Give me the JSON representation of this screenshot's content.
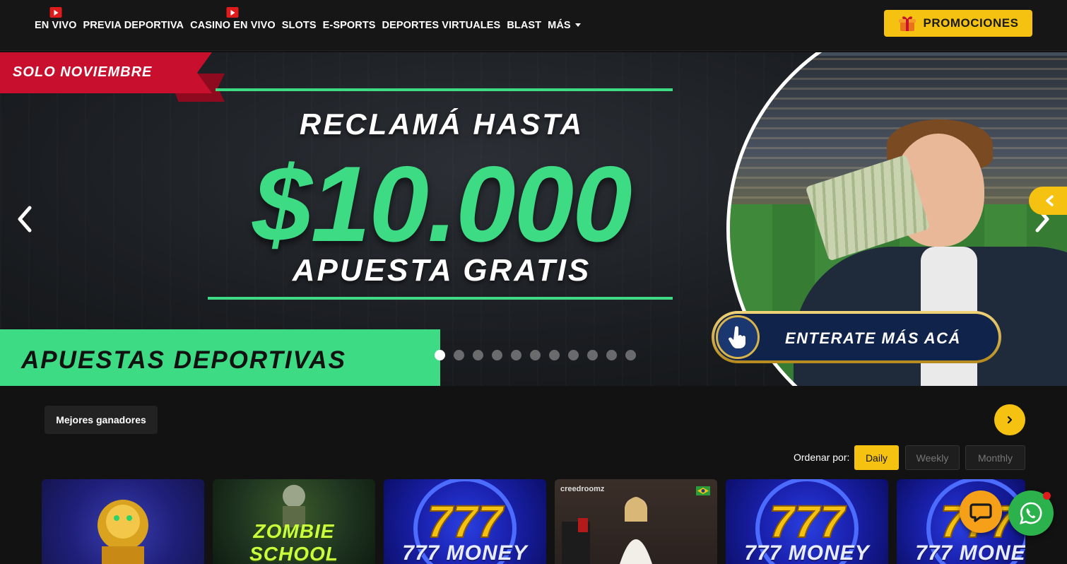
{
  "nav": {
    "items": [
      {
        "label": "EN VIVO",
        "live": true
      },
      {
        "label": "PREVIA DEPORTIVA",
        "live": false
      },
      {
        "label": "CASINO EN VIVO",
        "live": true
      },
      {
        "label": "SLOTS",
        "live": false
      },
      {
        "label": "E-SPORTS",
        "live": false
      },
      {
        "label": "DEPORTES VIRTUALES",
        "live": false
      },
      {
        "label": "BLAST",
        "live": false
      },
      {
        "label": "MÁS",
        "live": false
      }
    ],
    "promo_label": "PROMOCIONES"
  },
  "banner": {
    "ribbon": "SOLO NOVIEMBRE",
    "claim": "RECLAMÁ HASTA",
    "amount": "$10.000",
    "subtitle": "APUESTA GRATIS",
    "category": "APUESTAS DEPORTIVAS",
    "cta": "ENTERATE MÁS ACÁ",
    "slide_count": 11,
    "active_slide": 1
  },
  "winners": {
    "title": "Mejores ganadores",
    "sort_label": "Ordenar por:",
    "periods": [
      "Daily",
      "Weekly",
      "Monthly"
    ],
    "active_period": "Daily",
    "games": [
      {
        "title": "",
        "theme": "lion"
      },
      {
        "title": "ZOMBIE SCHOOL",
        "theme": "zombie"
      },
      {
        "title": "777 MONEY",
        "theme": "money"
      },
      {
        "title": "creedroomz",
        "theme": "live"
      },
      {
        "title": "777 MONEY",
        "theme": "money"
      },
      {
        "title": "777 MONEY",
        "theme": "money"
      }
    ]
  },
  "colors": {
    "accent": "#f5c211",
    "banner_green": "#3ddc84",
    "ribbon_red": "#c8102e",
    "whatsapp": "#2bb24c"
  }
}
